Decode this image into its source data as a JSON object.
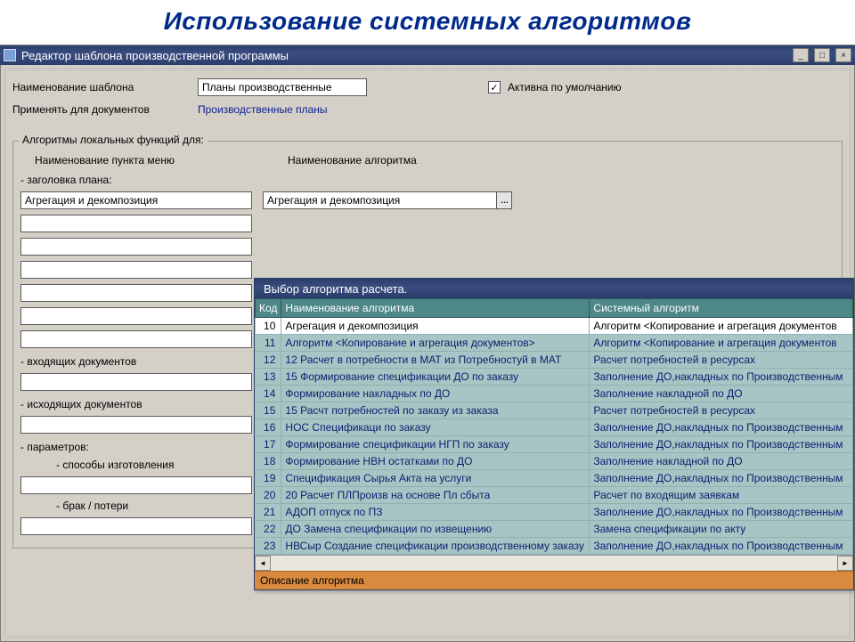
{
  "slide_title": "Использование системных алгоритмов",
  "editor": {
    "window_title": "Редактор шаблона производственной программы",
    "name_label": "Наименование шаблона",
    "name_value": "Планы производственные",
    "apply_label": "Применять для документов",
    "apply_link": "Производственные планы",
    "active_checkbox_label": "Активна по умолчанию",
    "active_checked": "✓",
    "group_legend": "Алгоритмы локальных функций для:",
    "col_menu": "Наименование пункта меню",
    "col_algo": "Наименование алгоритма",
    "sub_plan_header": "- заголовка плана:",
    "plan_header_menu_value": "Агрегация и декомпозиция",
    "plan_header_algo_value": "Агрегация и декомпозиция",
    "combo_btn": "…",
    "sub_incoming": "- входящих документов",
    "sub_outgoing": "- исходящих документов",
    "sub_params": "- параметров:",
    "sub_methods": "- способы изготовления",
    "sub_loss": "- брак / потери"
  },
  "picker": {
    "window_title": "Выбор алгоритма расчета.",
    "th_code": "Код",
    "th_name": "Наименование алгоритма",
    "th_sys": "Системный алгоритм",
    "desc_label": "Описание алгоритма",
    "rows": [
      {
        "code": "10",
        "name": "Агрегация и декомпозиция",
        "sys": "Алгоритм  <Копирование и агрегация документов"
      },
      {
        "code": "11",
        "name": "Алгоритм  <Копирование и агрегация документов>",
        "sys": "Алгоритм  <Копирование и агрегация документов"
      },
      {
        "code": "12",
        "name": "12 Расчет в потребности в МАТ из Потребностуй в МАТ",
        "sys": "Расчет потребностей в ресурсах"
      },
      {
        "code": "13",
        "name": "15 Формирование спецификации ДО по заказу",
        "sys": "Заполнение ДО,накладных по Производственным"
      },
      {
        "code": "14",
        "name": "Формирование накладных по ДО",
        "sys": "Заполнение накладной по ДО"
      },
      {
        "code": "15",
        "name": "15 Расчт потребностей по заказу из заказа",
        "sys": "Расчет потребностей в ресурсах"
      },
      {
        "code": "16",
        "name": "НОС  Спецификаци  по заказу",
        "sys": "Заполнение ДО,накладных по Производственным"
      },
      {
        "code": "17",
        "name": "Формирование спецификации НГП по заказу",
        "sys": "Заполнение ДО,накладных по Производственным"
      },
      {
        "code": "18",
        "name": "Формирование НВН остатками по ДО",
        "sys": "Заполнение накладной по ДО"
      },
      {
        "code": "19",
        "name": "Спецификация Сырья Акта на услуги",
        "sys": "Заполнение ДО,накладных по Производственным"
      },
      {
        "code": "20",
        "name": "20 Расчет ПЛПроизв на основе Пл сбыта",
        "sys": "Расчет по входящим заявкам"
      },
      {
        "code": "21",
        "name": "АДОП отпуск по ПЗ",
        "sys": "Заполнение ДО,накладных по Производственным"
      },
      {
        "code": "22",
        "name": "ДО Замена спецификации по извещению",
        "sys": "Замена спецификации по акту"
      },
      {
        "code": "23",
        "name": "НВСыр  Создание спецификации производственному заказу",
        "sys": "Заполнение ДО,накладных по Производственным"
      }
    ]
  }
}
